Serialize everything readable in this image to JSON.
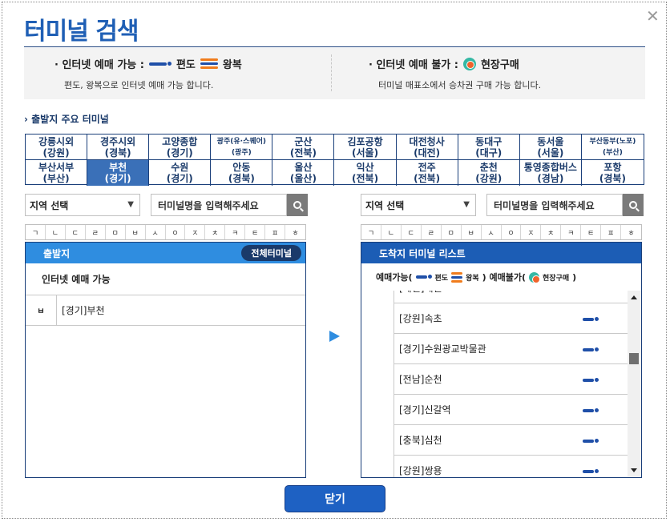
{
  "dialog": {
    "title": "터미널 검색",
    "close_symbol": "✕"
  },
  "info": {
    "available_label": "· 인터넷 예매 가능 :",
    "oneway_label": "편도",
    "round_label": "왕복",
    "available_desc": "편도, 왕복으로 인터넷 예매 가능 합니다.",
    "unavailable_label": "· 인터넷 예매 불가 :",
    "onsite_label": "현장구매",
    "unavailable_desc": "터미널 매표소에서 승차권 구매 가능 합니다."
  },
  "major": {
    "heading": "출발지 주요 터미널",
    "terminals": [
      {
        "name": "강릉시외",
        "region": "(강원)",
        "small": false,
        "active": false
      },
      {
        "name": "경주시외",
        "region": "(경북)",
        "small": false,
        "active": false
      },
      {
        "name": "고양종합",
        "region": "(경기)",
        "small": false,
        "active": false
      },
      {
        "name": "광주(유·스퀘어)",
        "region": "(광주)",
        "small": true,
        "active": false
      },
      {
        "name": "군산",
        "region": "(전북)",
        "small": false,
        "active": false
      },
      {
        "name": "김포공항",
        "region": "(서울)",
        "small": false,
        "active": false
      },
      {
        "name": "대전청사",
        "region": "(대전)",
        "small": false,
        "active": false
      },
      {
        "name": "동대구",
        "region": "(대구)",
        "small": false,
        "active": false
      },
      {
        "name": "동서울",
        "region": "(서울)",
        "small": false,
        "active": false
      },
      {
        "name": "부산동부(노포)",
        "region": "(부산)",
        "small": true,
        "active": false
      },
      {
        "name": "부산서부",
        "region": "(부산)",
        "small": false,
        "active": false
      },
      {
        "name": "부천",
        "region": "(경기)",
        "small": false,
        "active": true
      },
      {
        "name": "수원",
        "region": "(경기)",
        "small": false,
        "active": false
      },
      {
        "name": "안동",
        "region": "(경북)",
        "small": false,
        "active": false
      },
      {
        "name": "울산",
        "region": "(울산)",
        "small": false,
        "active": false
      },
      {
        "name": "익산",
        "region": "(전북)",
        "small": false,
        "active": false
      },
      {
        "name": "전주",
        "region": "(전북)",
        "small": false,
        "active": false
      },
      {
        "name": "춘천",
        "region": "(강원)",
        "small": false,
        "active": false
      },
      {
        "name": "통영종합버스",
        "region": "(경남)",
        "small": false,
        "active": false
      },
      {
        "name": "포항",
        "region": "(경북)",
        "small": false,
        "active": false
      }
    ]
  },
  "search": {
    "region_select": "지역 선택",
    "placeholder": "터미널명을 입력해주세요"
  },
  "consonants": [
    "ㄱ",
    "ㄴ",
    "ㄷ",
    "ㄹ",
    "ㅁ",
    "ㅂ",
    "ㅅ",
    "ㅇ",
    "ㅈ",
    "ㅊ",
    "ㅋ",
    "ㅌ",
    "ㅍ",
    "ㅎ"
  ],
  "departure": {
    "header": "출발지",
    "all_button": "전체터미널",
    "subheader": "인터넷 예매 가능",
    "row_initial": "ㅂ",
    "row_value": "[경기]부천"
  },
  "destination": {
    "header": "도착지 터미널 리스트",
    "legend_a": "예매가능(",
    "legend_oneway": "편도",
    "legend_round": "왕복",
    "legend_b": ") 예매불가(",
    "legend_onsite": "현장구매",
    "legend_c": ")",
    "items": [
      "[제천]제천",
      "[강원]속초",
      "[경기]수원광교박물관",
      "[전남]순천",
      "[경기]신갈역",
      "[충북]심천",
      "[강원]쌍용"
    ]
  },
  "footer": {
    "close_button": "닫기"
  }
}
